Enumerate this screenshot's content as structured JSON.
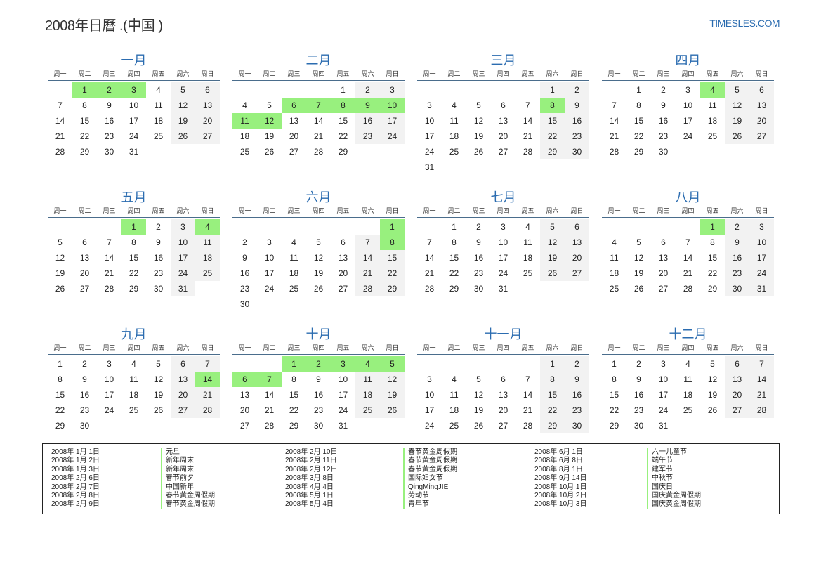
{
  "header": {
    "title": "2008年日曆 .(中国 )",
    "brand": "TIMESLES.COM"
  },
  "weekdays": [
    "周一",
    "周二",
    "周三",
    "周四",
    "周五",
    "周六",
    "周日"
  ],
  "months": [
    {
      "name": "一月",
      "offset": 1,
      "days": 31,
      "holidays": [
        1,
        2,
        3
      ]
    },
    {
      "name": "二月",
      "offset": 4,
      "days": 29,
      "holidays": [
        6,
        7,
        8,
        9,
        10,
        11,
        12
      ]
    },
    {
      "name": "三月",
      "offset": 5,
      "days": 31,
      "holidays": [
        8
      ]
    },
    {
      "name": "四月",
      "offset": 1,
      "days": 30,
      "holidays": [
        4
      ]
    },
    {
      "name": "五月",
      "offset": 3,
      "days": 31,
      "holidays": [
        1,
        4
      ]
    },
    {
      "name": "六月",
      "offset": 6,
      "days": 30,
      "holidays": [
        1,
        8
      ]
    },
    {
      "name": "七月",
      "offset": 1,
      "days": 31,
      "holidays": []
    },
    {
      "name": "八月",
      "offset": 4,
      "days": 31,
      "holidays": [
        1
      ]
    },
    {
      "name": "九月",
      "offset": 0,
      "days": 30,
      "holidays": [
        14
      ]
    },
    {
      "name": "十月",
      "offset": 2,
      "days": 31,
      "holidays": [
        1,
        2,
        3,
        4,
        5,
        6,
        7
      ]
    },
    {
      "name": "十一月",
      "offset": 5,
      "days": 30,
      "holidays": []
    },
    {
      "name": "十二月",
      "offset": 0,
      "days": 31,
      "holidays": []
    }
  ],
  "holidays": [
    {
      "date": "2008年 1月 1日",
      "name": "元旦"
    },
    {
      "date": "2008年 1月 2日",
      "name": "新年周末"
    },
    {
      "date": "2008年 1月 3日",
      "name": "新年周末"
    },
    {
      "date": "2008年 2月 6日",
      "name": "春节前夕"
    },
    {
      "date": "2008年 2月 7日",
      "name": "中国新年"
    },
    {
      "date": "2008年 2月 8日",
      "name": "春节黄金周假期"
    },
    {
      "date": "2008年 2月 9日",
      "name": "春节黄金周假期"
    },
    {
      "date": "2008年 2月 10日",
      "name": "春节黄金周假期"
    },
    {
      "date": "2008年 2月 11日",
      "name": "春节黄金周假期"
    },
    {
      "date": "2008年 2月 12日",
      "name": "春节黄金周假期"
    },
    {
      "date": "2008年 3月 8日",
      "name": "国际妇女节"
    },
    {
      "date": "2008年 4月 4日",
      "name": "QingMingJIE"
    },
    {
      "date": "2008年 5月 1日",
      "name": "劳动节"
    },
    {
      "date": "2008年 5月 4日",
      "name": "青年节"
    },
    {
      "date": "2008年 6月 1日",
      "name": "六一儿童节"
    },
    {
      "date": "2008年 6月 8日",
      "name": "端午节"
    },
    {
      "date": "2008年 8月 1日",
      "name": "建军节"
    },
    {
      "date": "2008年 9月 14日",
      "name": "中秋节"
    },
    {
      "date": "2008年 10月 1日",
      "name": "国庆日"
    },
    {
      "date": "2008年 10月 2日",
      "name": "国庆黄金周假期"
    },
    {
      "date": "2008年 10月 3日",
      "name": "国庆黄金周假期"
    }
  ],
  "colors": {
    "accent": "#2b6cb0",
    "holiday": "#98f07e",
    "weekend": "#f2f2f2",
    "rule": "#4a6d8c"
  }
}
